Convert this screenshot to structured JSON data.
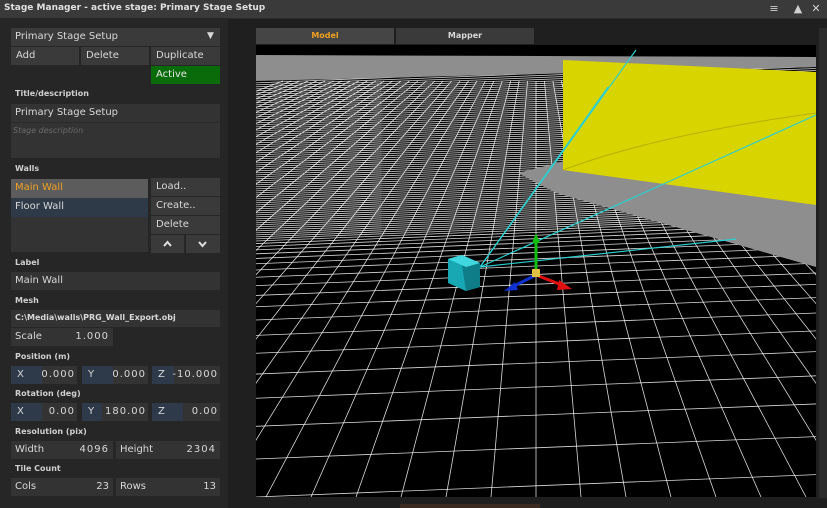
{
  "window": {
    "title": "Stage Manager - active stage: Primary Stage Setup"
  },
  "window_controls": {
    "menu": "≡",
    "collapse": "▲",
    "close": "✕"
  },
  "stage_select": {
    "value": "Primary Stage Setup",
    "arrow": "▼"
  },
  "stage_buttons": {
    "add": "Add",
    "delete": "Delete",
    "duplicate": "Duplicate",
    "active": "Active"
  },
  "title_section": {
    "label": "Title/description",
    "title_value": "Primary Stage Setup",
    "description_placeholder": "Stage description"
  },
  "walls_section": {
    "label": "Walls",
    "items": [
      {
        "label": "Main Wall"
      },
      {
        "label": "Floor Wall"
      }
    ],
    "buttons": {
      "load": "Load..",
      "create": "Create..",
      "delete": "Delete"
    }
  },
  "label_section": {
    "label": "Label",
    "value": "Main Wall"
  },
  "mesh_section": {
    "label": "Mesh",
    "path": "C:\\Media\\walls\\PRG_Wall_Export.obj",
    "scale_label": "Scale",
    "scale_value": "1.000"
  },
  "position_section": {
    "label": "Position (m)",
    "x_label": "X",
    "x_value": "0.000",
    "y_label": "Y",
    "y_value": "0.000",
    "z_label": "Z",
    "z_value": "-10.000"
  },
  "rotation_section": {
    "label": "Rotation (deg)",
    "x_label": "X",
    "x_value": "0.00",
    "y_label": "Y",
    "y_value": "180.00",
    "z_label": "Z",
    "z_value": "0.00"
  },
  "resolution_section": {
    "label": "Resolution (pix)",
    "width_label": "Width",
    "width_value": "4096",
    "height_label": "Height",
    "height_value": "2304"
  },
  "tilecount_section": {
    "label": "Tile Count",
    "cols_label": "Cols",
    "cols_value": "23",
    "rows_label": "Rows",
    "rows_value": "13"
  },
  "tabs": [
    {
      "label": "Model"
    },
    {
      "label": "Mapper"
    }
  ],
  "colors": {
    "active_green": "#0a6b0a",
    "selected_text": "#f0a020",
    "tab_active_text": "#f0a020",
    "wall_yellow": "#d8d400",
    "floor_gray": "#8e8e8e",
    "grid_white": "#ffffff",
    "projector_cyan": "#2ad0d0"
  }
}
